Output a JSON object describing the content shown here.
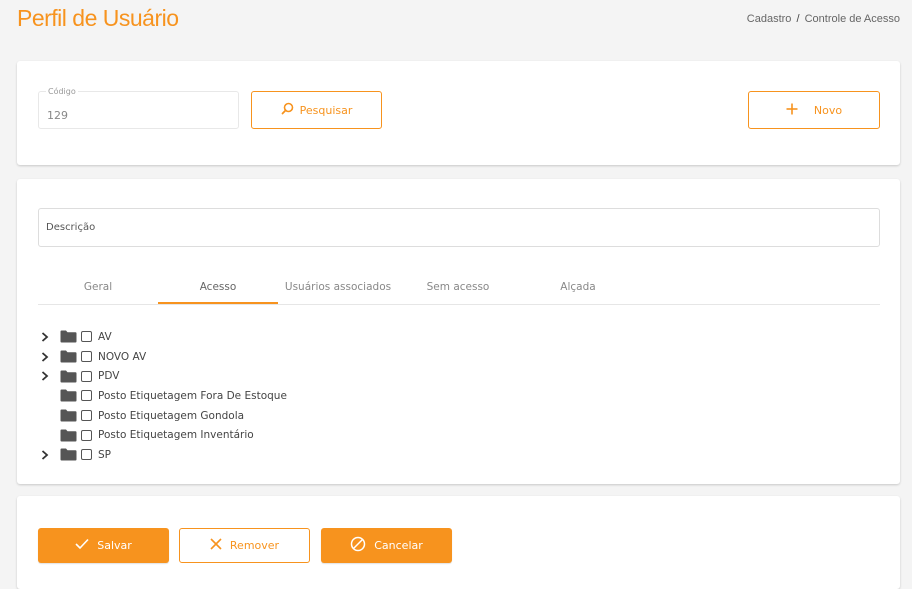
{
  "header": {
    "title": "Perfil de Usuário",
    "breadcrumb": {
      "parent": "Cadastro",
      "separator": "/",
      "current": "Controle de Acesso"
    }
  },
  "search": {
    "code_label": "Código",
    "code_value": "129",
    "search_label": "Pesquisar",
    "new_label": "Novo"
  },
  "form": {
    "description_label": "Descrição",
    "tabs": [
      {
        "label": "Geral",
        "active": false
      },
      {
        "label": "Acesso",
        "active": true
      },
      {
        "label": "Usuários associados",
        "active": false
      },
      {
        "label": "Sem acesso",
        "active": false
      },
      {
        "label": "Alçada",
        "active": false
      }
    ],
    "tree": [
      {
        "label": "AV",
        "expandable": true,
        "checked": false
      },
      {
        "label": "NOVO AV",
        "expandable": true,
        "checked": false
      },
      {
        "label": "PDV",
        "expandable": true,
        "checked": false
      },
      {
        "label": "Posto Etiquetagem Fora De Estoque",
        "expandable": false,
        "checked": false
      },
      {
        "label": "Posto Etiquetagem Gondola",
        "expandable": false,
        "checked": false
      },
      {
        "label": "Posto Etiquetagem Inventário",
        "expandable": false,
        "checked": false
      },
      {
        "label": "SP",
        "expandable": true,
        "checked": false
      }
    ]
  },
  "actions": {
    "save_label": "Salvar",
    "remove_label": "Remover",
    "cancel_label": "Cancelar"
  },
  "colors": {
    "accent": "#f7931e",
    "folder": "#555555",
    "background": "#f4f4f4"
  }
}
